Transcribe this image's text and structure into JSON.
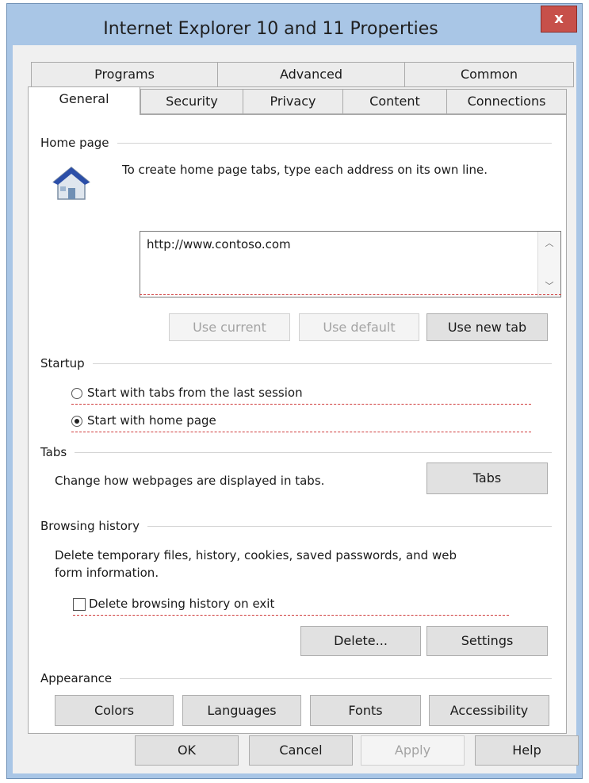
{
  "window": {
    "title": "Internet Explorer 10 and 11 Properties",
    "close_glyph": "x"
  },
  "tabs": {
    "top_row": [
      "Programs",
      "Advanced",
      "Common"
    ],
    "bottom_row": [
      "General",
      "Security",
      "Privacy",
      "Content",
      "Connections"
    ],
    "selected": "General"
  },
  "home_page": {
    "heading": "Home page",
    "instruction": "To create home page tabs, type each address on its own line.",
    "address": "http://www.contoso.com",
    "icon": "house-icon",
    "use_current": "Use current",
    "use_default": "Use default",
    "use_new_tab": "Use new tab"
  },
  "startup": {
    "heading": "Startup",
    "option_last_session": "Start with tabs from the last session",
    "option_home_page": "Start with home page",
    "selected": "Start with home page"
  },
  "tabs_section": {
    "heading": "Tabs",
    "description": "Change how webpages are displayed in tabs.",
    "button": "Tabs"
  },
  "browsing_history": {
    "heading": "Browsing history",
    "description_line1": "Delete temporary files, history, cookies, saved passwords, and web",
    "description_line2": "form information.",
    "delete_on_exit_label": "Delete browsing history on exit",
    "delete_on_exit_checked": false,
    "delete_button": "Delete...",
    "settings_button": "Settings"
  },
  "appearance": {
    "heading": "Appearance",
    "colors": "Colors",
    "languages": "Languages",
    "fonts": "Fonts",
    "accessibility": "Accessibility"
  },
  "footer": {
    "ok": "OK",
    "cancel": "Cancel",
    "apply": "Apply",
    "help": "Help"
  },
  "colors": {
    "titlebar": "#a9c6e6",
    "close_button": "#c7504a",
    "spellcheck_underline": "#cf3b3b"
  }
}
